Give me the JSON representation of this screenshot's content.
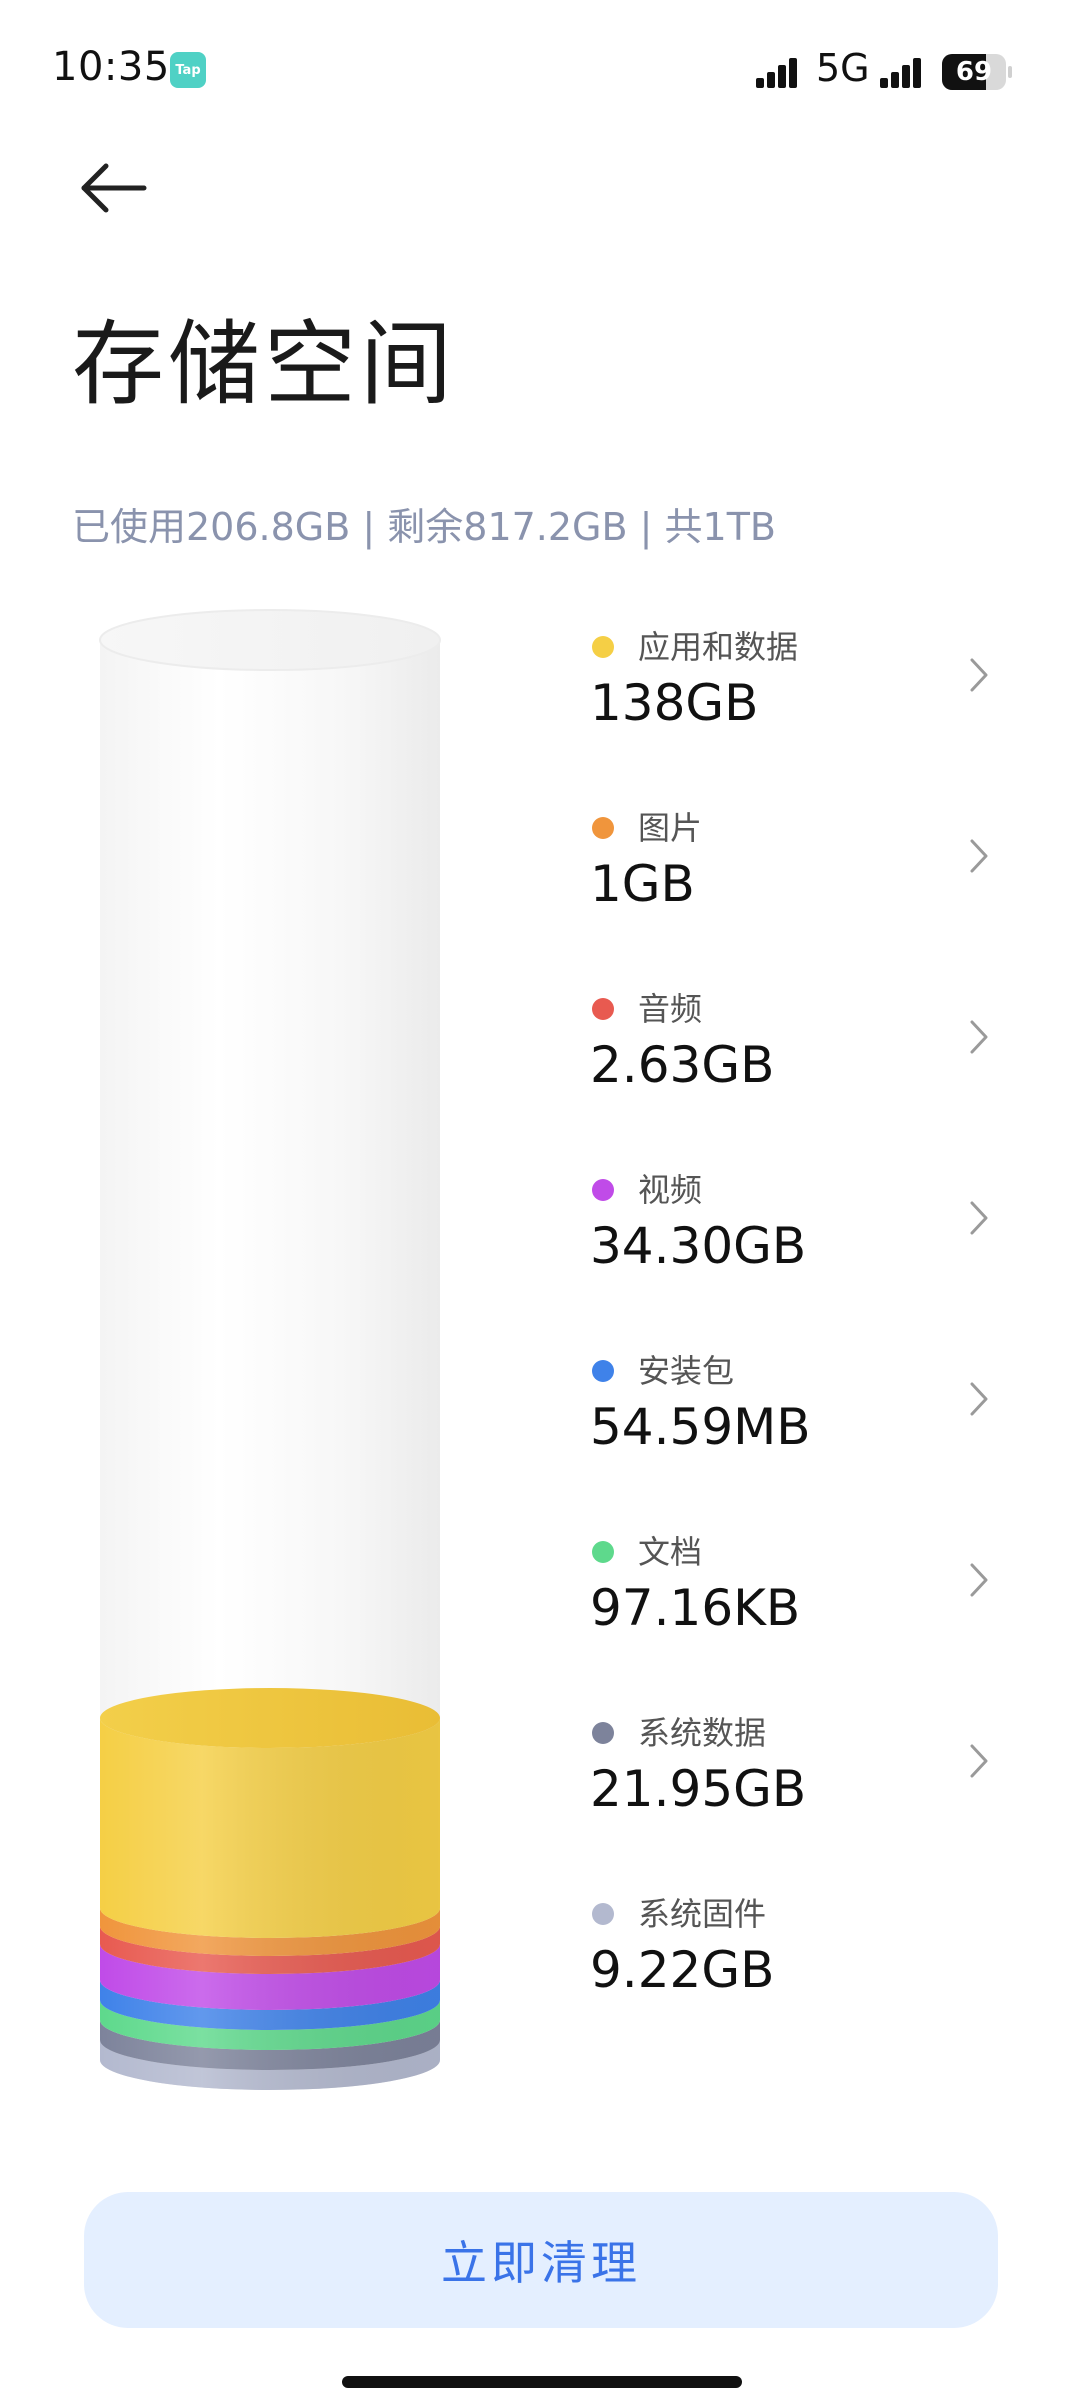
{
  "status_bar": {
    "time": "10:35",
    "app_badge": "Tap",
    "network": "5G",
    "battery_level": 69,
    "battery_text": "69"
  },
  "page": {
    "title": "存储空间",
    "summary": "已使用206.8GB | 剩余817.2GB | 共1TB"
  },
  "categories": [
    {
      "label": "应用和数据",
      "value": "138GB",
      "color": "#f5cf45",
      "has_chevron": true
    },
    {
      "label": "图片",
      "value": "1GB",
      "color": "#f0953c",
      "has_chevron": true
    },
    {
      "label": "音频",
      "value": "2.63GB",
      "color": "#e85a50",
      "has_chevron": true
    },
    {
      "label": "视频",
      "value": "34.30GB",
      "color": "#c04be8",
      "has_chevron": true
    },
    {
      "label": "安装包",
      "value": "54.59MB",
      "color": "#3f82e9",
      "has_chevron": true
    },
    {
      "label": "文档",
      "value": "97.16KB",
      "color": "#5ed98c",
      "has_chevron": true
    },
    {
      "label": "系统数据",
      "value": "21.95GB",
      "color": "#7d839b",
      "has_chevron": true
    },
    {
      "label": "系统固件",
      "value": "9.22GB",
      "color": "#b3b9cf",
      "has_chevron": false
    }
  ],
  "actions": {
    "clean_button": "立即清理"
  },
  "icons": {
    "back": "arrow-left-icon",
    "chevron": "chevron-right-icon"
  }
}
